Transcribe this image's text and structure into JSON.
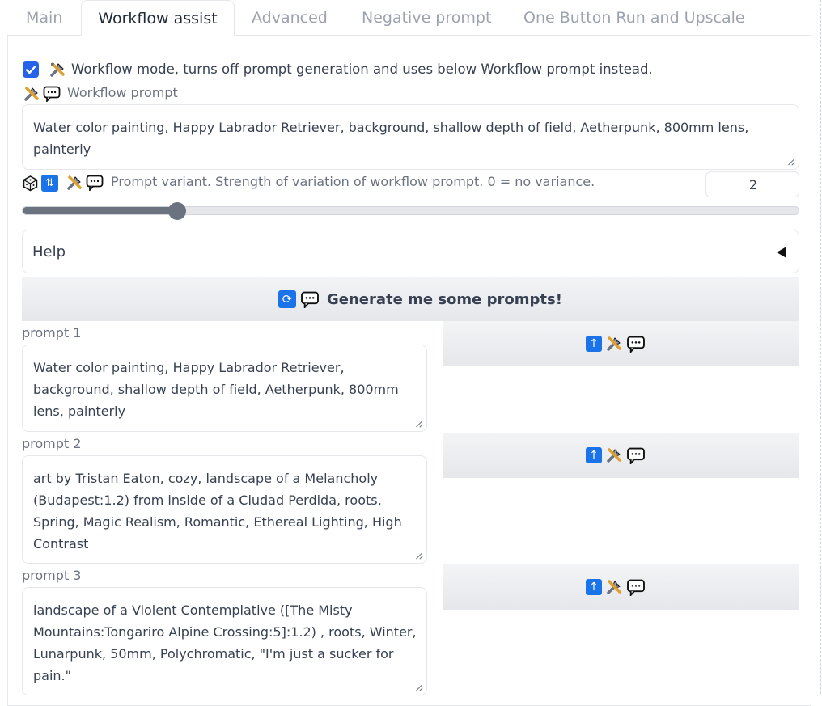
{
  "tabs": [
    {
      "label": "Main",
      "active": false
    },
    {
      "label": "Workflow assist",
      "active": true
    },
    {
      "label": "Advanced",
      "active": false
    },
    {
      "label": "Negative prompt",
      "active": false
    },
    {
      "label": "One Button Run and Upscale",
      "active": false
    }
  ],
  "workflow_mode": {
    "checked": true,
    "label": "Workflow mode, turns off prompt generation and uses below Workflow prompt instead."
  },
  "workflow_prompt": {
    "label": "Workflow prompt",
    "value": "Water color painting, Happy Labrador Retriever, background, shallow depth of field, Aetherpunk, 800mm lens, painterly"
  },
  "variant": {
    "label": "Prompt variant. Strength of variation of workflow prompt. 0 = no variance.",
    "value": "2",
    "slider_fraction": 0.2
  },
  "help": {
    "label": "Help"
  },
  "generate_button": {
    "label": "Generate me some prompts!"
  },
  "prompts": [
    {
      "label": "prompt 1",
      "value": "Water color painting, Happy Labrador Retriever,\nbackground, shallow depth of field, Aetherpunk, 800mm\nlens, painterly"
    },
    {
      "label": "prompt 2",
      "value": "art by Tristan Eaton, cozy, landscape of a Melancholy\n(Budapest:1.2) from inside of a Ciudad Perdida, roots,\nSpring, Magic Realism, Romantic, Ethereal Lighting, High\nContrast"
    },
    {
      "label": "prompt 3",
      "value": "landscape of a Violent Contemplative ([The Misty\nMountains:Tongariro Alpine Crossing:5]:1.2) , roots, Winter,\nLunarpunk, 50mm, Polychromatic, \"I'm just a sucker for\npain.\""
    }
  ],
  "colors": {
    "accent": "#1a73e8",
    "checkbox": "#2563eb",
    "slider_fill": "#6b7280"
  },
  "icons": [
    "tools-icon",
    "speech-bubble-icon",
    "dice-icon",
    "shuffle-icon",
    "refresh-icon",
    "up-arrow-icon"
  ]
}
